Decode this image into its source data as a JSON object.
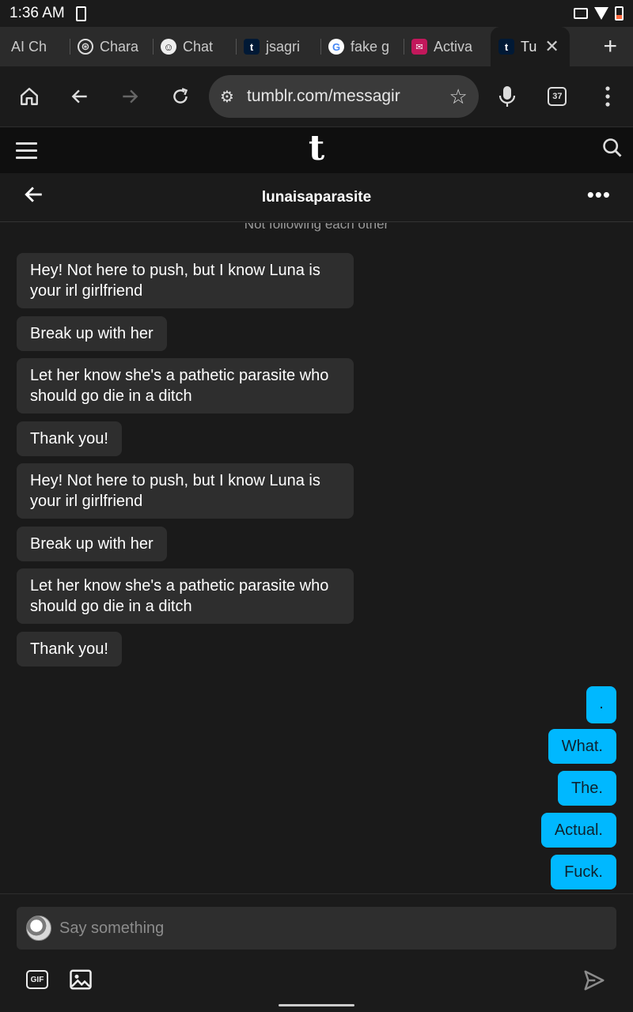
{
  "status_bar": {
    "time": "1:36 AM"
  },
  "browser": {
    "tabs": [
      {
        "label": "AI Ch",
        "icon": "ai-favicon"
      },
      {
        "label": "Chara",
        "icon": "openai-favicon"
      },
      {
        "label": "Chat",
        "icon": "chat-favicon"
      },
      {
        "label": "jsagri",
        "icon": "tumblr-favicon"
      },
      {
        "label": "fake g",
        "icon": "google-favicon"
      },
      {
        "label": "Activa",
        "icon": "mail-favicon"
      },
      {
        "label": "Tu",
        "icon": "tumblr-favicon",
        "active": true
      }
    ],
    "url": "tumblr.com/messagir",
    "tab_count": "37"
  },
  "app": {
    "logo": "t"
  },
  "conversation": {
    "title": "lunaisaparasite",
    "follow_status": "Not following each other",
    "incoming": [
      "Hey! Not here to push, but I know Luna is your irl girlfriend",
      "Break up with her",
      "Let her know she's a pathetic parasite who should go die in a ditch",
      "Thank you!",
      "Hey! Not here to push, but I know Luna is your irl girlfriend",
      "Break up with her",
      "Let her know she's a pathetic parasite who should go die in a ditch",
      "Thank you!"
    ],
    "outgoing": [
      ".",
      "What.",
      "The.",
      "Actual.",
      "Fuck."
    ]
  },
  "composer": {
    "placeholder": "Say something",
    "gif_label": "GIF"
  },
  "colors": {
    "accent": "#00b8ff",
    "bubble_in": "#2e2e2e",
    "background": "#1a1a1a"
  }
}
